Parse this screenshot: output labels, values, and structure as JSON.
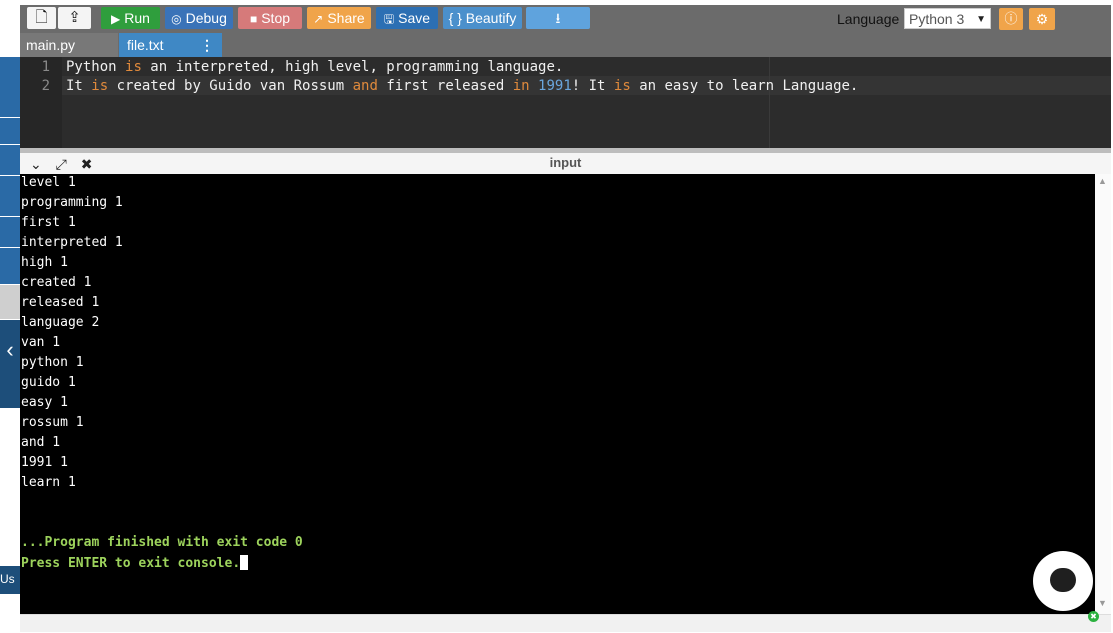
{
  "toolbar": {
    "new_icon": "file-icon",
    "upload_icon": "upload-icon",
    "run_label": "Run",
    "debug_label": "Debug",
    "stop_label": "Stop",
    "share_label": "Share",
    "save_label": "Save",
    "beautify_label": "{ } Beautify",
    "download_icon": "download-icon",
    "language_label": "Language",
    "language_value": "Python 3"
  },
  "tabs": [
    {
      "label": "main.py",
      "active": false
    },
    {
      "label": "file.txt",
      "active": true
    }
  ],
  "editor": {
    "lines": [
      {
        "num": "1"
      },
      {
        "num": "2"
      }
    ],
    "line1": {
      "a": "Python ",
      "kw1": "is",
      "b": " an interpreted, high level, programming language."
    },
    "line2": {
      "a": "It ",
      "kw1": "is",
      "b": " created by Guido van Rossum ",
      "kw2": "and",
      "c": " first released ",
      "kw3": "in",
      "d": " ",
      "num": "1991",
      "e": "! It ",
      "kw4": "is",
      "f": " an easy to learn Language."
    }
  },
  "io_panel": {
    "title": "input"
  },
  "console": {
    "lines": [
      "level 1",
      "programming 1",
      "first 1",
      "interpreted 1",
      "high 1",
      "created 1",
      "released 1",
      "language 2",
      "van 1",
      "python 1",
      "guido 1",
      "easy 1",
      "rossum 1",
      "and 1",
      "1991 1",
      "learn 1"
    ],
    "finished": "...Program finished with exit code 0",
    "press_enter": "Press ENTER to exit console."
  },
  "sidebar": {
    "toggle_icon": "chevron-left-icon",
    "us_label": "Us"
  },
  "colors": {
    "run": "#2f9e3d",
    "debug": "#3a73b8",
    "stop": "#d67a7a",
    "share": "#f0a44a",
    "save": "#2c6fb3",
    "active_tab": "#3f88c5",
    "console_bg": "#000000",
    "console_green": "#9dd35c"
  }
}
